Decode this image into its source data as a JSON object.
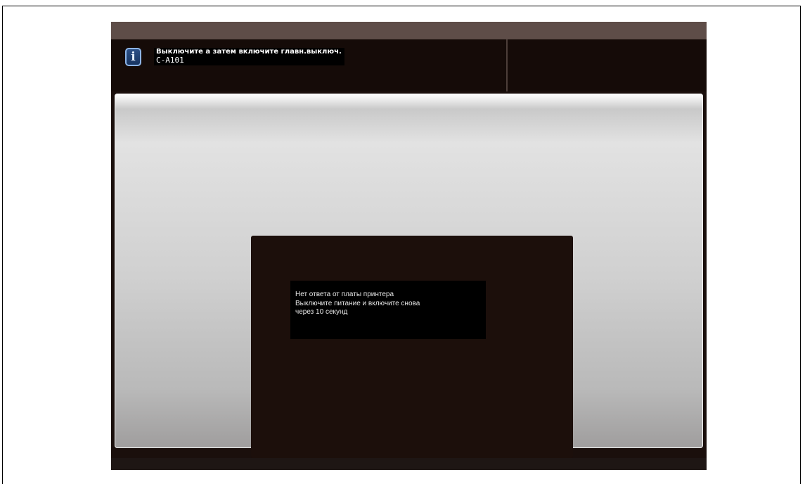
{
  "header": {
    "icon": "info-icon",
    "icon_glyph": "i",
    "message": "Выключите а затем включите главн.выключ.",
    "code": "C-A101"
  },
  "dialog": {
    "lines": [
      "Нет ответа от платы принтера",
      "Выключите питание и включите снова",
      "через 10 секунд"
    ]
  },
  "colors": {
    "panel_background": "#1a0f0c",
    "header_background": "#150b08",
    "top_strip": "#5e4d48",
    "info_icon_border": "#8db4e6",
    "info_icon_fill": "#2b4f86"
  }
}
